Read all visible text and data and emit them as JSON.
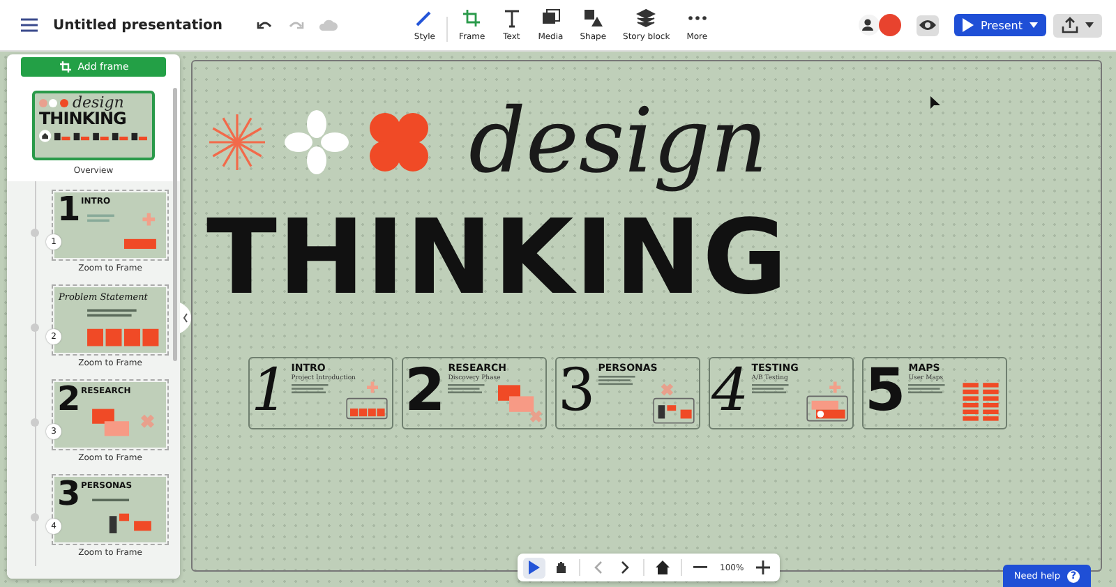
{
  "header": {
    "title": "Untitled presentation"
  },
  "tools": [
    {
      "kind": "style",
      "label": "Style"
    },
    {
      "kind": "frame",
      "label": "Frame"
    },
    {
      "kind": "text",
      "label": "Text"
    },
    {
      "kind": "media",
      "label": "Media"
    },
    {
      "kind": "shape",
      "label": "Shape"
    },
    {
      "kind": "story",
      "label": "Story block"
    },
    {
      "kind": "more",
      "label": "More"
    }
  ],
  "present_button": "Present",
  "sidebar": {
    "add_frame": "Add frame",
    "overview": {
      "label": "Overview",
      "title_script": "design",
      "title_bold": "THINKING"
    },
    "frames": [
      {
        "number": "1",
        "label": "Zoom to Frame",
        "kind": "intro",
        "digit": "1",
        "heading": "INTRO"
      },
      {
        "number": "2",
        "label": "Zoom to Frame",
        "kind": "statement",
        "heading": "Problem Statement"
      },
      {
        "number": "3",
        "label": "Zoom to Frame",
        "kind": "research",
        "digit": "2",
        "heading": "RESEARCH"
      },
      {
        "number": "4",
        "label": "Zoom to Frame",
        "kind": "personas",
        "digit": "3",
        "heading": "PERSONAS"
      }
    ]
  },
  "canvas": {
    "title_script": "design",
    "title_bold": "THINKING",
    "frames": [
      {
        "number": "1",
        "kind": "serif-italic",
        "heading": "INTRO",
        "subheading": "Project Introduction"
      },
      {
        "number": "2",
        "kind": "bold",
        "heading": "RESEARCH",
        "subheading": "Discovery Phase"
      },
      {
        "number": "3",
        "kind": "serif",
        "heading": "PERSONAS"
      },
      {
        "number": "4",
        "kind": "serif-italic",
        "heading": "TESTING",
        "subheading": "A/B Testing"
      },
      {
        "number": "5",
        "kind": "bold",
        "heading": "MAPS",
        "subheading": "User Maps"
      }
    ]
  },
  "zoom": {
    "level_text": "100%"
  },
  "help_button": "Need help",
  "help_icon": "?"
}
